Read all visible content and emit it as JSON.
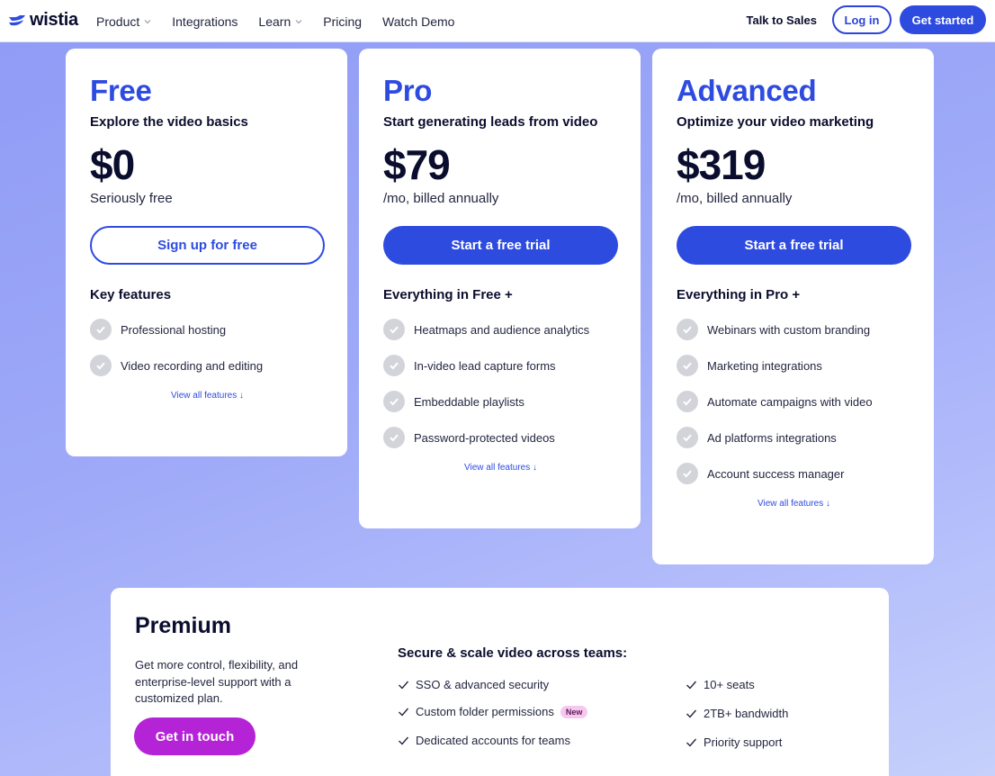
{
  "brand": {
    "name": "wistia",
    "accent": "#2e4be0",
    "premium_button_color": "#b523d6"
  },
  "nav": {
    "items": [
      {
        "label": "Product",
        "has_dropdown": true
      },
      {
        "label": "Integrations",
        "has_dropdown": false
      },
      {
        "label": "Learn",
        "has_dropdown": true
      },
      {
        "label": "Pricing",
        "has_dropdown": false
      },
      {
        "label": "Watch Demo",
        "has_dropdown": false
      }
    ],
    "talk_to_sales": "Talk to Sales",
    "login": "Log in",
    "get_started": "Get started"
  },
  "plans": [
    {
      "name": "Free",
      "tagline": "Explore the video basics",
      "price": "$0",
      "price_note": "Seriously free",
      "cta": "Sign up for free",
      "features_heading": "Key features",
      "features": [
        "Professional hosting",
        "Video recording and editing"
      ],
      "view_all": "View all features ↓"
    },
    {
      "name": "Pro",
      "tagline": "Start generating leads from video",
      "price": "$79",
      "price_note": "/mo, billed annually",
      "cta": "Start a free trial",
      "features_heading": "Everything in Free +",
      "features": [
        "Heatmaps and audience analytics",
        "In-video lead capture forms",
        "Embeddable playlists",
        "Password-protected videos"
      ],
      "view_all": "View all features ↓"
    },
    {
      "name": "Advanced",
      "tagline": "Optimize your video marketing",
      "price": "$319",
      "price_note": "/mo, billed annually",
      "cta": "Start a free trial",
      "features_heading": "Everything in Pro +",
      "features": [
        "Webinars with custom branding",
        "Marketing integrations",
        "Automate campaigns with video",
        "Ad platforms integrations",
        "Account success manager"
      ],
      "view_all": "View all features ↓"
    }
  ],
  "premium": {
    "title": "Premium",
    "description": "Get more control, flexibility, and enterprise-level support with a customized plan.",
    "cta": "Get in touch",
    "heading": "Secure & scale video across teams:",
    "features_left": [
      "SSO & advanced security",
      "Custom folder permissions",
      "Dedicated accounts for teams"
    ],
    "badge": "New",
    "features_right": [
      "10+ seats",
      "2TB+ bandwidth",
      "Priority support"
    ]
  }
}
